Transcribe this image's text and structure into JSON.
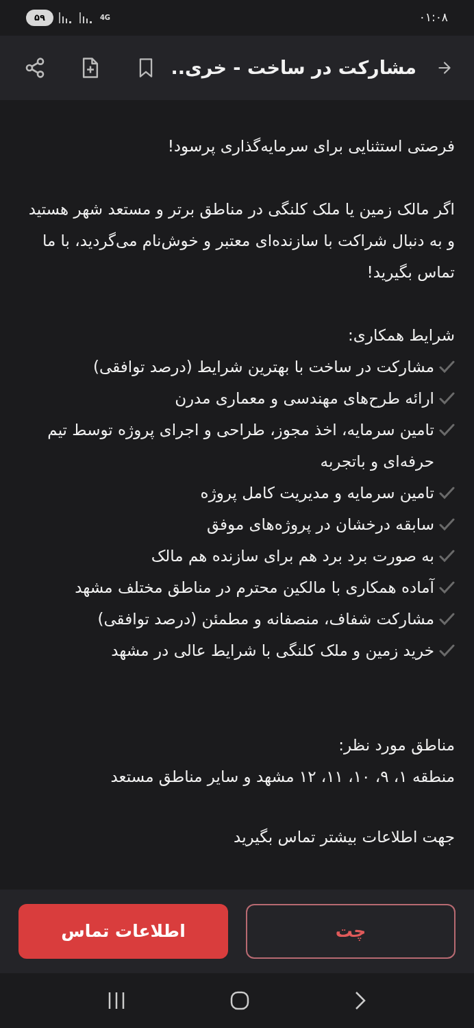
{
  "status_bar": {
    "time": "۰۱:۰۸",
    "battery": "۵۹",
    "network": "4G"
  },
  "header": {
    "title": "مشارکت در ساخت - خری.."
  },
  "body": {
    "intro": "فرصتی استثنایی برای سرمایه‌گذاری پرسود!",
    "paragraph": "اگر مالک زمین یا ملک کلنگی در مناطق برتر و مستعد شهر هستید و به دنبال شراکت با سازنده‌ای معتبر و خوش‌نام می‌گردید، با ما تماس بگیرید!",
    "terms_heading": "شرایط همکاری:",
    "terms": [
      {
        "text": "مشارکت در ساخت با بهترین شرایط (درصد توافقی)"
      },
      {
        "text": "ارائه طرح‌های مهندسی و معماری مدرن"
      },
      {
        "text": "تامین سرمایه، اخذ مجوز، طراحی و اجرای پروژه توسط تیم حرفه‌ای و باتجربه"
      },
      {
        "text": "تامین سرمایه و مدیریت کامل پروژه"
      },
      {
        "text": "سابقه درخشان در پروژه‌های موفق"
      },
      {
        "text": "به صورت برد برد هم برای سازنده هم مالک"
      },
      {
        "text": "آماده همکاری با مالکین محترم در مناطق مختلف مشهد"
      },
      {
        "text": "مشارکت شفاف، منصفانه و مطمئن (درصد توافقی)"
      },
      {
        "text": "خرید زمین و ملک کلنگی با شرایط عالی در مشهد"
      }
    ],
    "areas_heading": "مناطق مورد نظر:",
    "areas": "منطقه ۱، ۹، ۱۰، ۱۱، ۱۲ مشهد و سایر مناطق مستعد",
    "closing": "جهت اطلاعات بیشتر تماس بگیرید"
  },
  "actions": {
    "chat": "چت",
    "contact": "اطلاعات تماس"
  }
}
